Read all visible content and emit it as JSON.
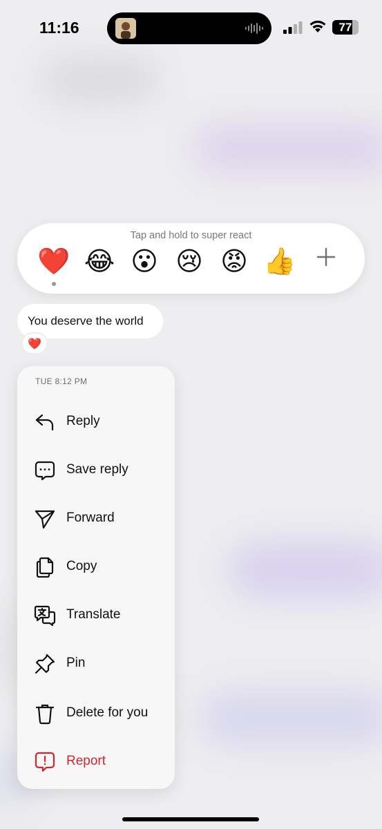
{
  "status_bar": {
    "time": "11:16",
    "battery_level": "77",
    "battery_percent": 77
  },
  "reactions": {
    "hint": "Tap and hold to super react",
    "items": [
      {
        "name": "red-heart",
        "glyph": "❤️",
        "selected": true
      },
      {
        "name": "face-with-tears-of-joy",
        "glyph": "😂"
      },
      {
        "name": "face-with-open-mouth",
        "glyph": "😮"
      },
      {
        "name": "crying-face",
        "glyph": "😢"
      },
      {
        "name": "angry-face",
        "glyph": "😡"
      },
      {
        "name": "thumbs-up",
        "glyph": "👍"
      }
    ],
    "more_icon": "plus-icon"
  },
  "message": {
    "text": "You deserve the world",
    "reaction": "❤️"
  },
  "menu": {
    "timestamp": "TUE 8:12 PM",
    "items": [
      {
        "label": "Reply",
        "icon": "reply-icon"
      },
      {
        "label": "Save reply",
        "icon": "save-reply-icon"
      },
      {
        "label": "Forward",
        "icon": "forward-icon"
      },
      {
        "label": "Copy",
        "icon": "copy-icon"
      },
      {
        "label": "Translate",
        "icon": "translate-icon"
      },
      {
        "label": "Pin",
        "icon": "pin-icon"
      },
      {
        "label": "Delete for you",
        "icon": "trash-icon"
      },
      {
        "label": "Report",
        "icon": "report-icon",
        "color": "#d3262a"
      }
    ]
  },
  "colors": {
    "background": "#eeeef0",
    "menu_background": "#f7f7f8",
    "danger": "#d3262a"
  }
}
